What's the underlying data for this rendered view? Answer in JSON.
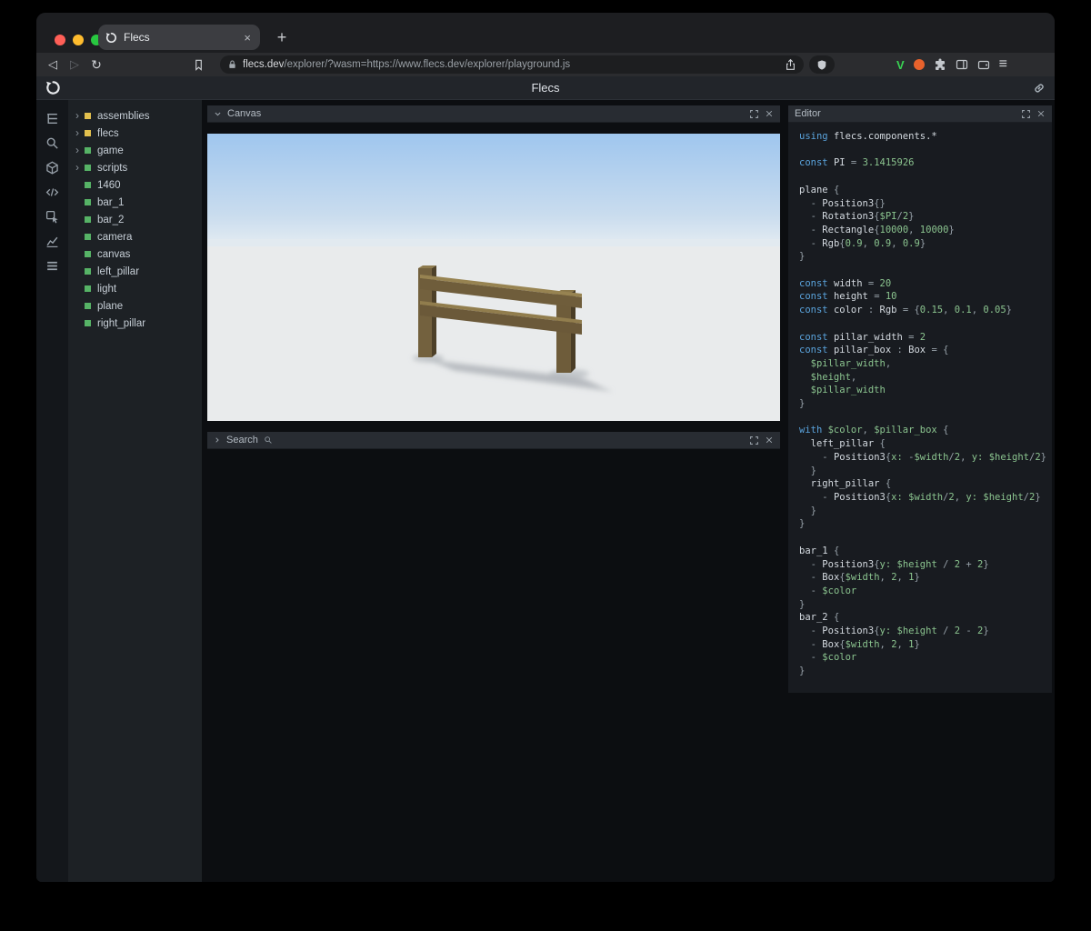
{
  "colors": {
    "keyword": "#5aa3dc",
    "identifier": "#d4dae0",
    "number": "#8bc48f",
    "variable": "#8bc48f",
    "punctuation": "#96a0a8",
    "entity_module": "#e2c04e",
    "entity_active": "#56b366",
    "accent_green_v": "#39d353",
    "accent_orange": "#e8622c"
  },
  "icons": {
    "back": "◁",
    "forward": "▷",
    "reload": "↻",
    "menu": "≡",
    "v_logo": "V"
  },
  "browser": {
    "tab": {
      "title": "Flecs",
      "close": "×"
    },
    "new_tab_button": "+",
    "url": {
      "domain": "flecs.dev",
      "path": "/explorer/?wasm=https://www.flecs.dev/explorer/playground.js"
    }
  },
  "app": {
    "header_title": "Flecs"
  },
  "panels": {
    "canvas": {
      "title": "Canvas"
    },
    "search": {
      "title": "Search"
    },
    "editor": {
      "title": "Editor"
    }
  },
  "tree": {
    "items": [
      {
        "label": "assemblies",
        "kind": "module",
        "expandable": true
      },
      {
        "label": "flecs",
        "kind": "module",
        "expandable": true
      },
      {
        "label": "game",
        "kind": "entity",
        "expandable": true
      },
      {
        "label": "scripts",
        "kind": "entity",
        "expandable": true
      },
      {
        "label": "1460",
        "kind": "entity",
        "expandable": false
      },
      {
        "label": "bar_1",
        "kind": "entity",
        "expandable": false
      },
      {
        "label": "bar_2",
        "kind": "entity",
        "expandable": false
      },
      {
        "label": "camera",
        "kind": "entity",
        "expandable": false
      },
      {
        "label": "canvas",
        "kind": "entity",
        "expandable": false
      },
      {
        "label": "left_pillar",
        "kind": "entity",
        "expandable": false
      },
      {
        "label": "light",
        "kind": "entity",
        "expandable": false
      },
      {
        "label": "plane",
        "kind": "entity",
        "expandable": false
      },
      {
        "label": "right_pillar",
        "kind": "entity",
        "expandable": false
      }
    ]
  },
  "code": {
    "lines": [
      [
        [
          "k",
          "using "
        ],
        [
          "i",
          "flecs.components.*"
        ]
      ],
      [],
      [
        [
          "k",
          "const "
        ],
        [
          "i",
          "PI "
        ],
        [
          "p",
          "= "
        ],
        [
          "n",
          "3.1415926"
        ]
      ],
      [],
      [
        [
          "i",
          "plane "
        ],
        [
          "p",
          "{"
        ]
      ],
      [
        [
          "p",
          "  - "
        ],
        [
          "i",
          "Position3"
        ],
        [
          "p",
          "{}"
        ]
      ],
      [
        [
          "p",
          "  - "
        ],
        [
          "i",
          "Rotation3"
        ],
        [
          "p",
          "{"
        ],
        [
          "v",
          "$PI"
        ],
        [
          "p",
          "/"
        ],
        [
          "n",
          "2"
        ],
        [
          "p",
          "}"
        ]
      ],
      [
        [
          "p",
          "  - "
        ],
        [
          "i",
          "Rectangle"
        ],
        [
          "p",
          "{"
        ],
        [
          "n",
          "10000"
        ],
        [
          "p",
          ", "
        ],
        [
          "n",
          "10000"
        ],
        [
          "p",
          "}"
        ]
      ],
      [
        [
          "p",
          "  - "
        ],
        [
          "i",
          "Rgb"
        ],
        [
          "p",
          "{"
        ],
        [
          "n",
          "0.9"
        ],
        [
          "p",
          ", "
        ],
        [
          "n",
          "0.9"
        ],
        [
          "p",
          ", "
        ],
        [
          "n",
          "0.9"
        ],
        [
          "p",
          "}"
        ]
      ],
      [
        [
          "p",
          "}"
        ]
      ],
      [],
      [
        [
          "k",
          "const "
        ],
        [
          "i",
          "width "
        ],
        [
          "p",
          "= "
        ],
        [
          "n",
          "20"
        ]
      ],
      [
        [
          "k",
          "const "
        ],
        [
          "i",
          "height "
        ],
        [
          "p",
          "= "
        ],
        [
          "n",
          "10"
        ]
      ],
      [
        [
          "k",
          "const "
        ],
        [
          "i",
          "color "
        ],
        [
          "p",
          ": "
        ],
        [
          "i",
          "Rgb "
        ],
        [
          "p",
          "= {"
        ],
        [
          "n",
          "0.15"
        ],
        [
          "p",
          ", "
        ],
        [
          "n",
          "0.1"
        ],
        [
          "p",
          ", "
        ],
        [
          "n",
          "0.05"
        ],
        [
          "p",
          "}"
        ]
      ],
      [],
      [
        [
          "k",
          "const "
        ],
        [
          "i",
          "pillar_width "
        ],
        [
          "p",
          "= "
        ],
        [
          "n",
          "2"
        ]
      ],
      [
        [
          "k",
          "const "
        ],
        [
          "i",
          "pillar_box "
        ],
        [
          "p",
          ": "
        ],
        [
          "i",
          "Box "
        ],
        [
          "p",
          "= {"
        ]
      ],
      [
        [
          "v",
          "  $pillar_width"
        ],
        [
          "p",
          ","
        ]
      ],
      [
        [
          "v",
          "  $height"
        ],
        [
          "p",
          ","
        ]
      ],
      [
        [
          "v",
          "  $pillar_width"
        ]
      ],
      [
        [
          "p",
          "}"
        ]
      ],
      [],
      [
        [
          "k",
          "with "
        ],
        [
          "v",
          "$color"
        ],
        [
          "p",
          ", "
        ],
        [
          "v",
          "$pillar_box"
        ],
        [
          "p",
          " {"
        ]
      ],
      [
        [
          "i",
          "  left_pillar "
        ],
        [
          "p",
          "{"
        ]
      ],
      [
        [
          "p",
          "    - "
        ],
        [
          "i",
          "Position3"
        ],
        [
          "p",
          "{"
        ],
        [
          "v",
          "x:"
        ],
        [
          "p",
          " -"
        ],
        [
          "v",
          "$width"
        ],
        [
          "p",
          "/"
        ],
        [
          "n",
          "2"
        ],
        [
          "p",
          ", "
        ],
        [
          "v",
          "y:"
        ],
        [
          "p",
          " "
        ],
        [
          "v",
          "$height"
        ],
        [
          "p",
          "/"
        ],
        [
          "n",
          "2"
        ],
        [
          "p",
          "}"
        ]
      ],
      [
        [
          "p",
          "  }"
        ]
      ],
      [
        [
          "i",
          "  right_pillar "
        ],
        [
          "p",
          "{"
        ]
      ],
      [
        [
          "p",
          "    - "
        ],
        [
          "i",
          "Position3"
        ],
        [
          "p",
          "{"
        ],
        [
          "v",
          "x:"
        ],
        [
          "p",
          " "
        ],
        [
          "v",
          "$width"
        ],
        [
          "p",
          "/"
        ],
        [
          "n",
          "2"
        ],
        [
          "p",
          ", "
        ],
        [
          "v",
          "y:"
        ],
        [
          "p",
          " "
        ],
        [
          "v",
          "$height"
        ],
        [
          "p",
          "/"
        ],
        [
          "n",
          "2"
        ],
        [
          "p",
          "}"
        ]
      ],
      [
        [
          "p",
          "  }"
        ]
      ],
      [
        [
          "p",
          "}"
        ]
      ],
      [],
      [
        [
          "i",
          "bar_1 "
        ],
        [
          "p",
          "{"
        ]
      ],
      [
        [
          "p",
          "  - "
        ],
        [
          "i",
          "Position3"
        ],
        [
          "p",
          "{"
        ],
        [
          "v",
          "y:"
        ],
        [
          "p",
          " "
        ],
        [
          "v",
          "$height"
        ],
        [
          "p",
          " / "
        ],
        [
          "n",
          "2"
        ],
        [
          "p",
          " + "
        ],
        [
          "n",
          "2"
        ],
        [
          "p",
          "}"
        ]
      ],
      [
        [
          "p",
          "  - "
        ],
        [
          "i",
          "Box"
        ],
        [
          "p",
          "{"
        ],
        [
          "v",
          "$width"
        ],
        [
          "p",
          ", "
        ],
        [
          "n",
          "2"
        ],
        [
          "p",
          ", "
        ],
        [
          "n",
          "1"
        ],
        [
          "p",
          "}"
        ]
      ],
      [
        [
          "p",
          "  - "
        ],
        [
          "v",
          "$color"
        ]
      ],
      [
        [
          "p",
          "}"
        ]
      ],
      [
        [
          "i",
          "bar_2 "
        ],
        [
          "p",
          "{"
        ]
      ],
      [
        [
          "p",
          "  - "
        ],
        [
          "i",
          "Position3"
        ],
        [
          "p",
          "{"
        ],
        [
          "v",
          "y:"
        ],
        [
          "p",
          " "
        ],
        [
          "v",
          "$height"
        ],
        [
          "p",
          " / "
        ],
        [
          "n",
          "2"
        ],
        [
          "p",
          " - "
        ],
        [
          "n",
          "2"
        ],
        [
          "p",
          "}"
        ]
      ],
      [
        [
          "p",
          "  - "
        ],
        [
          "i",
          "Box"
        ],
        [
          "p",
          "{"
        ],
        [
          "v",
          "$width"
        ],
        [
          "p",
          ", "
        ],
        [
          "n",
          "2"
        ],
        [
          "p",
          ", "
        ],
        [
          "n",
          "1"
        ],
        [
          "p",
          "}"
        ]
      ],
      [
        [
          "p",
          "  - "
        ],
        [
          "v",
          "$color"
        ]
      ],
      [
        [
          "p",
          "}"
        ]
      ]
    ]
  }
}
